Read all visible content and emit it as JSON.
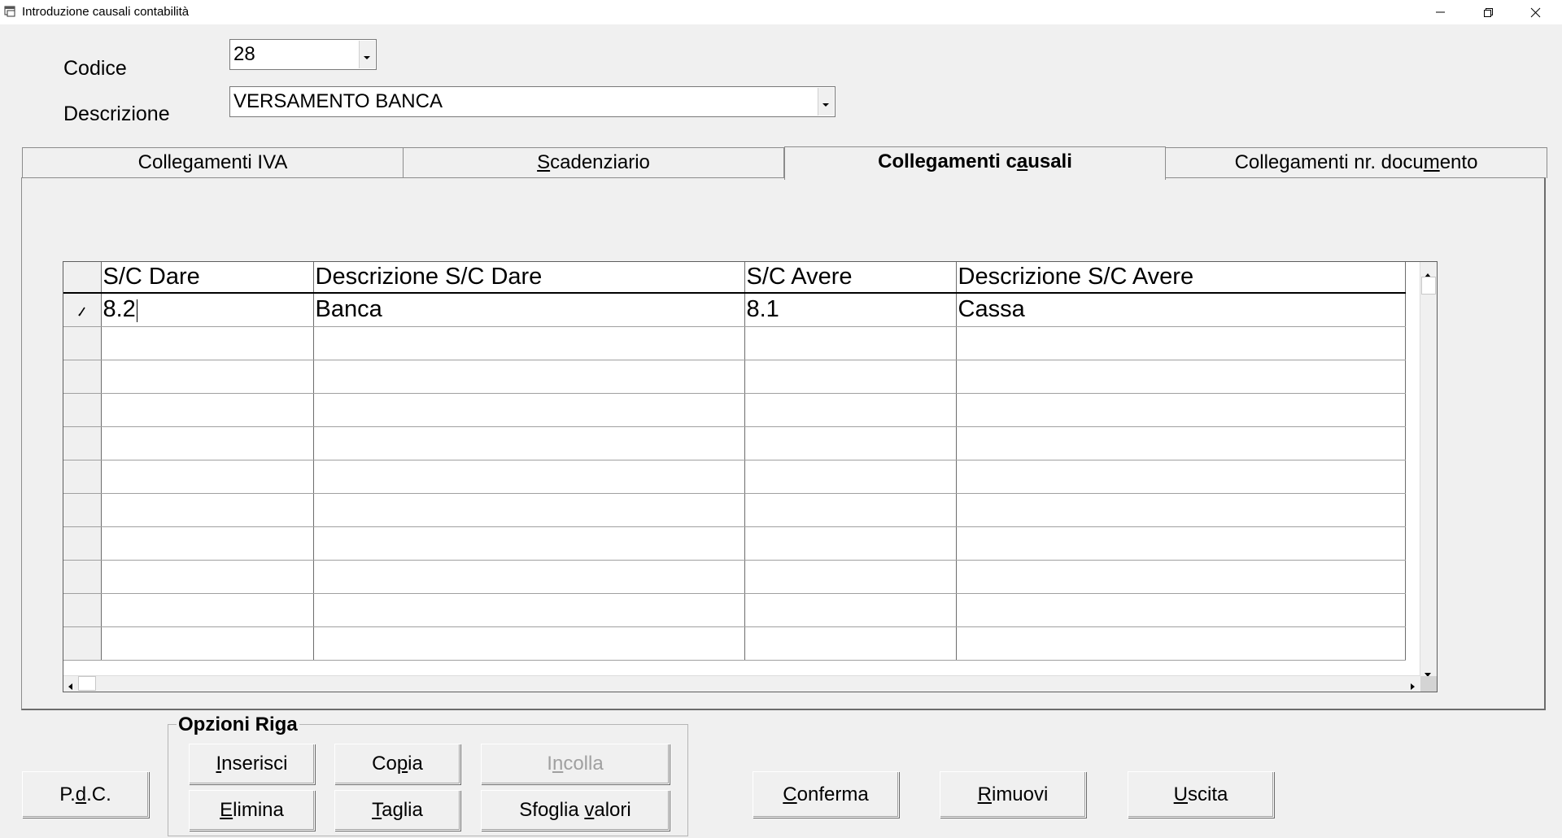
{
  "window": {
    "title": "Introduzione causali contabilità",
    "icon": "app-window-icon",
    "controls": [
      "minimize-icon",
      "restore-icon",
      "close-icon"
    ]
  },
  "form": {
    "codice": {
      "label": "Codice",
      "value": "28"
    },
    "descrizione": {
      "label": "Descrizione",
      "value": "VERSAMENTO BANCA"
    }
  },
  "tabs": [
    {
      "pre": "Colle",
      "u": "g",
      "post": "amenti IVA",
      "active": false
    },
    {
      "pre": "",
      "u": "S",
      "post": "cadenziario",
      "active": false
    },
    {
      "pre": "Collegamenti c",
      "u": "a",
      "post": "usali",
      "active": true
    },
    {
      "pre": "Collegamenti nr. docu",
      "u": "m",
      "post": "ento",
      "active": false
    }
  ],
  "grid": {
    "columns": [
      "S/C Dare",
      "Descrizione S/C Dare",
      "S/C Avere",
      "Descrizione S/C Avere"
    ],
    "rows": [
      [
        "8.2",
        "Banca",
        "8.1",
        "Cassa"
      ],
      [
        "",
        "",
        "",
        ""
      ],
      [
        "",
        "",
        "",
        ""
      ],
      [
        "",
        "",
        "",
        ""
      ],
      [
        "",
        "",
        "",
        ""
      ],
      [
        "",
        "",
        "",
        ""
      ],
      [
        "",
        "",
        "",
        ""
      ],
      [
        "",
        "",
        "",
        ""
      ],
      [
        "",
        "",
        "",
        ""
      ],
      [
        "",
        "",
        "",
        ""
      ],
      [
        "",
        "",
        "",
        ""
      ]
    ],
    "edit_row_indicator": "pencil-icon"
  },
  "row_options": {
    "title": "Opzioni Riga",
    "buttons": [
      {
        "pre": "",
        "u": "I",
        "post": "nserisci"
      },
      {
        "pre": "Co",
        "u": "p",
        "post": "ia"
      },
      {
        "pre": "I",
        "u": "n",
        "post": "colla",
        "disabled": true
      },
      {
        "pre": "",
        "u": "E",
        "post": "limina"
      },
      {
        "pre": "",
        "u": "T",
        "post": "aglia"
      },
      {
        "pre": "Sfoglia ",
        "u": "v",
        "post": "alori"
      }
    ]
  },
  "buttons": {
    "pdc": {
      "pre": "P.",
      "u": "d",
      "post": ".C."
    },
    "conferma": {
      "pre": "",
      "u": "C",
      "post": "onferma"
    },
    "rimuovi": {
      "pre": "",
      "u": "R",
      "post": "imuovi"
    },
    "uscita": {
      "pre": "",
      "u": "U",
      "post": "scita"
    }
  }
}
